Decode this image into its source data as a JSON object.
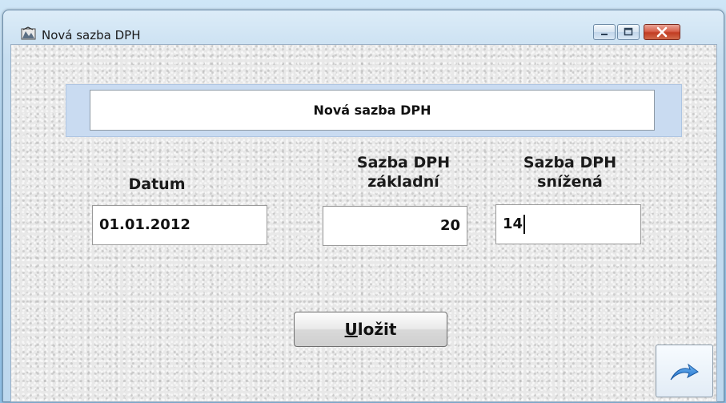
{
  "window": {
    "title": "Nová sazba DPH",
    "controls": {
      "minimize_icon": "minimize-icon",
      "maximize_icon": "maximize-icon",
      "close_icon": "close-icon"
    }
  },
  "form": {
    "header": "Nová sazba DPH",
    "fields": {
      "datum": {
        "label": "Datum",
        "value": "01.01.2012"
      },
      "zakladni": {
        "label_line1": "Sazba DPH",
        "label_line2": "základní",
        "value": "20"
      },
      "snizena": {
        "label_line1": "Sazba DPH",
        "label_line2": "snížená",
        "value": "14"
      }
    },
    "save_button": {
      "mnemonic": "U",
      "rest": "ložit"
    },
    "exit_button": {
      "icon": "exit-arrow-icon"
    }
  },
  "colors": {
    "header_frame": "#c9dbf1",
    "close_button": "#c23c22",
    "exit_arrow": "#1e6fc9"
  }
}
